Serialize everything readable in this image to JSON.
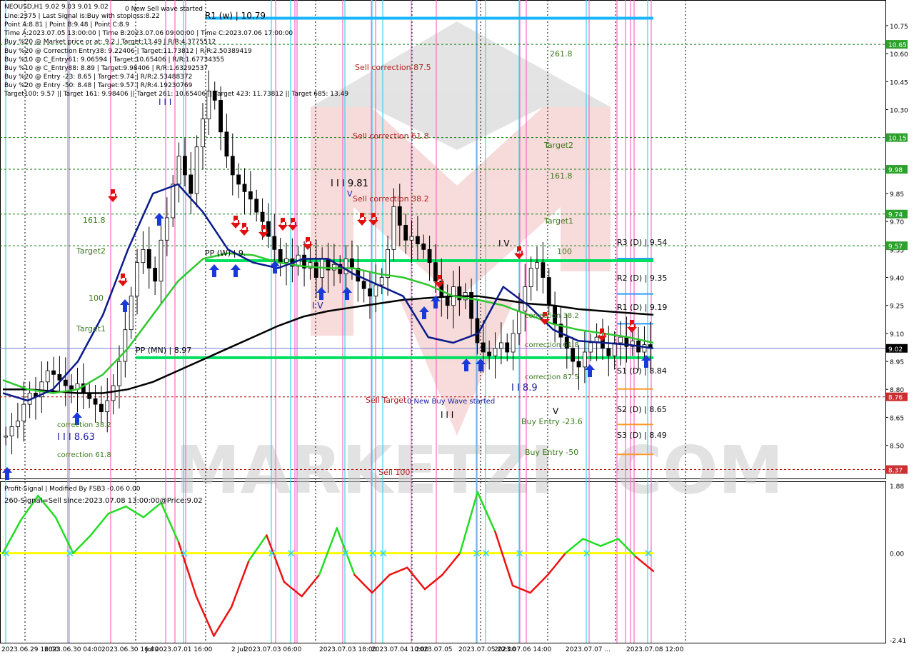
{
  "header": {
    "symbol_line": "NEOUSD,H1  9.02 9.03 9.01 9.02",
    "lines": [
      "Line:2375 | Last Signal is:Buy with stoploss:8.22",
      "Point A:8.81 | Point B:9.48 | Point C:8.9",
      "Time A:2023.07.05 13:00:00 | Time B:2023.07.06 09:00:00 | Time C:2023.07.06 17:00:00",
      "Buy %20 @ Market price or at: 9.2 | Target:13.49 | R/R:4.3775512",
      "Buy %20 @ Correction Entry38: 9.22406 | Target:11.73812 | R/R:2.50389419",
      "Buy %10 @ C_Entry61: 9.06594 | Target:10.65406 | R/R:1.67734355",
      "Buy %10 @ C_Entry88: 8.89 | Target:9.98406 | R/R:1.63292537",
      "Buy %20 @ Entry -23: 8.65 | Target:9.74 | R/R:2.53488372",
      "Buy %20 @ Entry -50: 8.48 | Target:9.57 | R/R:4.19230769",
      "Target100: 9.57 || Target 161: 9.98406 || Target 261: 10.65406 || Target 423: 11.73812 || Target 685: 13.49"
    ],
    "wave_status": "0 New Sell wave started"
  },
  "colors": {
    "green_line": "#00a000",
    "red_line": "#a00000",
    "pivot_green": "#00e060",
    "r1w_blue": "#19b5ff",
    "price_label_bg": "#000000",
    "sell_tag_bg": "#cc2f2f",
    "buy_tag_bg": "#2ea02e"
  },
  "axis": {
    "price_ticks": [
      "10.75",
      "10.60",
      "10.45",
      "10.30",
      "10.15",
      "9.98",
      "9.85",
      "9.70",
      "9.55",
      "9.40",
      "9.25",
      "9.10",
      "8.95",
      "8.80",
      "8.65",
      "8.50",
      "8.37"
    ],
    "indicator_ticks": [
      "1.88",
      "0.00",
      "-2.41"
    ],
    "time_labels": [
      "2023.06.29 16:00",
      "2023.06.30 04:00",
      "2023.06.30 16:00",
      "Jul",
      "2023.07.01 16:00",
      "2 Jul",
      "2023.07.03 06:00",
      "2023.07.03 18:00",
      "2023.07.04 10:00",
      "",
      "2023.07.05",
      "2023.07.05 22:00",
      "2023.07.06 14:00",
      "2023.07.07 ...",
      "2023.07.08 12:00"
    ]
  },
  "price_tags": [
    {
      "id": "target_261",
      "value": "10.65",
      "kind": "green",
      "price": 10.65
    },
    {
      "id": "target_2",
      "value": "10.15",
      "kind": "green",
      "price": 10.15
    },
    {
      "id": "target_161",
      "value": "9.98",
      "kind": "green",
      "price": 9.98
    },
    {
      "id": "target_1",
      "value": "9.74",
      "kind": "green",
      "price": 9.74
    },
    {
      "id": "target_100",
      "value": "9.57",
      "kind": "green",
      "price": 9.57
    },
    {
      "id": "current",
      "value": "9.02",
      "kind": "black",
      "price": 9.02
    },
    {
      "id": "stop_buy",
      "value": "8.76",
      "kind": "red",
      "price": 8.76
    },
    {
      "id": "stop_sell",
      "value": "8.37",
      "kind": "red",
      "price": 8.37
    }
  ],
  "labels": {
    "r1w": "R1 (w) | 10.79",
    "pp_w": "PP (W) | 9.",
    "pp_mn": "PP (MN) | 8.97",
    "r3d": "R3 (D) | 9.54",
    "r2d": "R2 (D) | 9.35",
    "r1d": "R1 (D) | 9.19",
    "s1d": "S1 (D) | 8.84",
    "s2d": "S2 (D) | 8.65",
    "s3d": "S3 (D) | 8.49",
    "fib_261": "261.8",
    "fib_target2": "Target2",
    "fib_161": "161.8",
    "fib_target1": "Target1",
    "fib_100": "100",
    "left_161": "161.8",
    "left_target2": "Target2",
    "left_100": "100",
    "left_target1": "Target1",
    "sell_corr_875": "Sell correction 87.5",
    "sell_corr_618": "Sell correction 61.8",
    "sell_corr_382": "Sell correction 38.2",
    "sell_target": "Sell Target",
    "new_buy_wave": "0 New Buy Wave started",
    "sell_100": "Sell 100",
    "wave_981": "I I I 9.81",
    "wave_v_top": "V",
    "wave_iv": "I V",
    "wave_89": "I I  8.9",
    "wave_v_low": "V",
    "wave_iii_low": "I I I",
    "wave_iii_top": "I I I",
    "wave_iv_left": "I V",
    "wave_left_863": "I I I 8.63",
    "corr_382": "correction 38.2",
    "corr_618": "correction 61.8",
    "corr_875": "correction 87.5",
    "corr_382_left": "correction 38.2",
    "corr_618_left": "correction 61.8",
    "buy_entry_236": "Buy Entry -23.6",
    "buy_entry_50": "Buy Entry -50",
    "watermark": "MARKETZI",
    "watermark_suffix": "COM"
  },
  "indicator": {
    "title": "Profit-Signal | Modified By FSB3 -0.06 0.00",
    "signal": "260-Signal=Sell since:2023.07.08 13:00:00@Price:9.02"
  },
  "chart_data": {
    "type": "candlestick",
    "title": "NEOUSD,H1",
    "ylim": [
      8.33,
      10.88
    ],
    "indicator_ylim": [
      -2.41,
      1.88
    ],
    "close_series": [
      8.55,
      8.6,
      8.63,
      8.72,
      8.78,
      8.76,
      8.84,
      8.9,
      8.88,
      8.85,
      8.82,
      8.8,
      8.83,
      8.78,
      8.75,
      8.72,
      8.68,
      8.74,
      8.82,
      8.95,
      9.12,
      9.3,
      9.48,
      9.55,
      9.45,
      9.38,
      9.6,
      9.72,
      9.9,
      10.05,
      9.95,
      9.85,
      10.1,
      10.25,
      10.4,
      10.35,
      10.18,
      10.05,
      9.95,
      9.9,
      9.86,
      9.82,
      9.75,
      9.7,
      9.62,
      9.55,
      9.48,
      9.5,
      9.46,
      9.52,
      9.45,
      9.48,
      9.4,
      9.5,
      9.44,
      9.47,
      9.42,
      9.5,
      9.45,
      9.38,
      9.34,
      9.3,
      9.36,
      9.4,
      9.55,
      9.78,
      9.68,
      9.6,
      9.62,
      9.58,
      9.55,
      9.48,
      9.38,
      9.3,
      9.25,
      9.35,
      9.28,
      9.32,
      9.18,
      9.05,
      9.0,
      8.98,
      9.02,
      9.05,
      9.0,
      9.1,
      9.22,
      9.35,
      9.45,
      9.48,
      9.4,
      9.25,
      9.15,
      9.08,
      9.02,
      8.95,
      8.92,
      9.0,
      9.05,
      9.08,
      9.02,
      8.98,
      9.05,
      9.08,
      9.03,
      9.06,
      9.0,
      9.04,
      9.02
    ],
    "ma_black": [
      8.8,
      8.8,
      8.79,
      8.78,
      8.78,
      8.8,
      8.84,
      8.9,
      8.96,
      9.02,
      9.08,
      9.14,
      9.19,
      9.22,
      9.24,
      9.26,
      9.28,
      9.29,
      9.3,
      9.3,
      9.28,
      9.26,
      9.25,
      9.23,
      9.22,
      9.21,
      9.2
    ],
    "ma_green": [
      8.85,
      8.8,
      8.78,
      8.8,
      8.88,
      9.02,
      9.2,
      9.38,
      9.5,
      9.53,
      9.52,
      9.48,
      9.46,
      9.45,
      9.45,
      9.42,
      9.4,
      9.36,
      9.3,
      9.28,
      9.25,
      9.2,
      9.15,
      9.12,
      9.1,
      9.08,
      9.05
    ],
    "ma_blue": [
      8.78,
      8.74,
      8.8,
      8.95,
      9.2,
      9.55,
      9.85,
      9.9,
      9.75,
      9.55,
      9.48,
      9.45,
      9.5,
      9.5,
      9.42,
      9.36,
      9.3,
      9.08,
      9.05,
      9.1,
      9.35,
      9.25,
      9.12,
      9.06,
      9.05,
      9.04,
      9.02
    ],
    "indicator_values": [
      0.0,
      0.9,
      1.6,
      1.0,
      0.0,
      0.5,
      1.1,
      1.3,
      1.0,
      1.4,
      0.3,
      -1.2,
      -2.3,
      -1.5,
      -0.2,
      0.5,
      -0.8,
      -1.2,
      -0.6,
      0.7,
      -0.6,
      -1.1,
      -0.6,
      -0.4,
      -1.0,
      -0.6,
      0.0,
      1.7,
      0.6,
      -0.9,
      -1.1,
      -0.6,
      0.0,
      0.4,
      0.2,
      0.4,
      -0.1,
      -0.5
    ],
    "levels": [
      {
        "name": "R1 (w)",
        "value": 10.79
      },
      {
        "name": "PP (W)",
        "value": 9.49
      },
      {
        "name": "PP (MN)",
        "value": 8.97
      },
      {
        "name": "R3 (D)",
        "value": 9.54
      },
      {
        "name": "R2 (D)",
        "value": 9.35
      },
      {
        "name": "R1 (D)",
        "value": 9.19
      },
      {
        "name": "S1 (D)",
        "value": 8.84
      },
      {
        "name": "S2 (D)",
        "value": 8.65
      },
      {
        "name": "S3 (D)",
        "value": 8.49
      }
    ]
  }
}
